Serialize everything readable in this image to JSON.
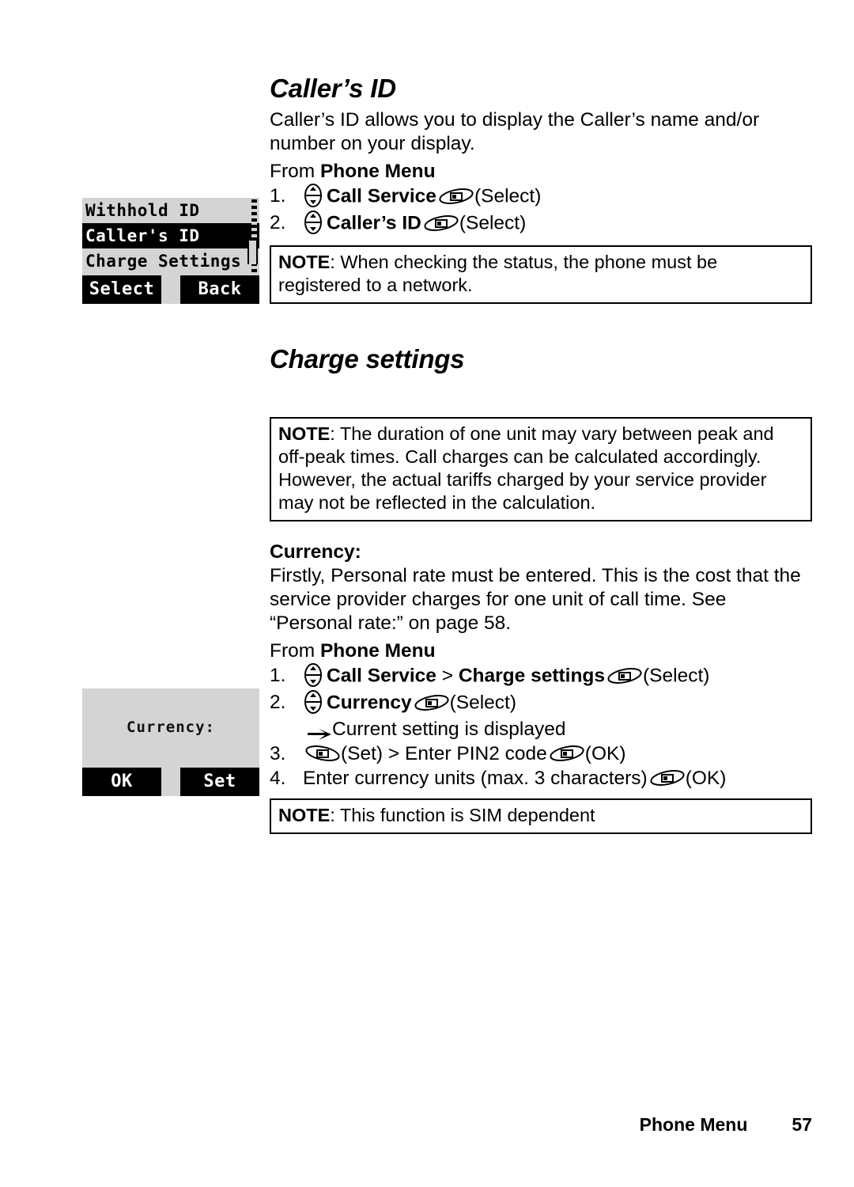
{
  "page": {
    "footer_label": "Phone Menu",
    "footer_page_number": "57"
  },
  "sections": [
    {
      "title": "Caller’s ID",
      "intro": "Caller’s ID allows you to display the Caller’s name and/or number on your display.",
      "from_prefix": "From ",
      "from_menu": "Phone Menu",
      "steps": [
        {
          "num": "1.",
          "nav_icon": "nav-key-icon",
          "bold_text": "Call Service",
          "soft_icon": "softkey-icon",
          "tail": "(Select)"
        },
        {
          "num": "2.",
          "nav_icon": "nav-key-icon",
          "bold_text": "Caller’s ID",
          "soft_icon": "softkey-icon",
          "tail": "(Select)"
        }
      ],
      "note": {
        "label": "NOTE",
        "text": ": When checking the status, the phone must be registered to a network."
      }
    },
    {
      "title": "Charge settings",
      "note": {
        "label": "NOTE",
        "text": ": The duration of one unit may vary between peak and off-peak times. Call charges can be calculated accordingly. However, the actual tariffs charged by your service provider may not be reflected in the calculation."
      },
      "subheading": "Currency:",
      "intro": "Firstly, Personal rate must be entered. This is the cost that the service provider charges for one unit of call time. See “Personal rate:” on page 58.",
      "from_prefix": "From ",
      "from_menu": "Phone Menu",
      "steps": [
        {
          "num": "1.",
          "bold_text": "Call Service",
          "separator": " > ",
          "bold_text2": "Charge settings",
          "tail": "(Select)"
        },
        {
          "num": "2.",
          "bold_text": "Currency",
          "tail": "(Select)"
        },
        {
          "num": "3.",
          "pre": "(Set) > Enter PIN2 code",
          "tail": "(OK)"
        },
        {
          "num": "4.",
          "plain_text": "Enter currency units (max. 3 characters)",
          "tail": "(OK)"
        }
      ],
      "substep": "Current setting is displayed",
      "note2": {
        "label": "NOTE",
        "text": ": This function is SIM dependent"
      }
    }
  ],
  "lcd_screens": [
    {
      "name": "callers-id-menu",
      "rows": [
        {
          "label": "Withhold ID",
          "selected": false
        },
        {
          "label": "Caller's ID",
          "selected": true
        },
        {
          "label": "Charge Settings",
          "selected": false
        }
      ],
      "softkey_left": "Select",
      "softkey_right": "Back",
      "scrollbar": true
    },
    {
      "name": "currency-prompt",
      "center_text": "Currency:",
      "softkey_left": "OK",
      "softkey_right": "Set",
      "scrollbar": false
    }
  ],
  "colors": {
    "lcd_background": "#d4d4d4",
    "lcd_highlight": "#000000",
    "lcd_highlight_text": "#ffffff",
    "page_background": "#ffffff",
    "text": "#000000"
  }
}
